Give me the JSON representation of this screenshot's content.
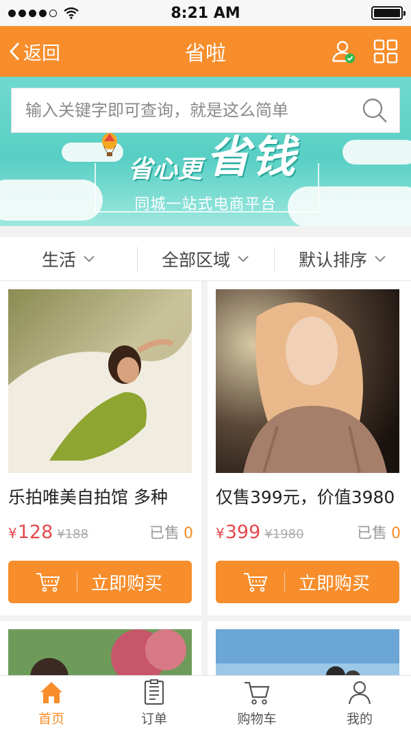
{
  "status_bar": {
    "time": "8:21 AM"
  },
  "header": {
    "back_label": "返回",
    "title": "省啦",
    "icons": [
      "user-verified-icon",
      "grid-icon"
    ]
  },
  "search": {
    "placeholder": "输入关键字即可查询，就是这么简单"
  },
  "banner": {
    "headline_small": "省心更",
    "headline_big": "省钱",
    "subtitle": "同城一站式电商平台"
  },
  "filters": [
    {
      "label": "生活"
    },
    {
      "label": "全部区域"
    },
    {
      "label": "默认排序"
    }
  ],
  "products": [
    {
      "title": "乐拍唯美自拍馆 多种",
      "currency": "¥",
      "price": "128",
      "old_price": "¥188",
      "sold_label": "已售",
      "sold_count": "0",
      "buy_label": "立即购买"
    },
    {
      "title": "仅售399元，价值3980",
      "currency": "¥",
      "price": "399",
      "old_price": "¥1980",
      "sold_label": "已售",
      "sold_count": "0",
      "buy_label": "立即购买"
    }
  ],
  "tabs": [
    {
      "label": "首页",
      "icon": "home-icon",
      "active": true
    },
    {
      "label": "订单",
      "icon": "order-icon",
      "active": false
    },
    {
      "label": "购物车",
      "icon": "cart-icon",
      "active": false
    },
    {
      "label": "我的",
      "icon": "profile-icon",
      "active": false
    }
  ],
  "colors": {
    "accent": "#f78d2b",
    "price": "#e5484d",
    "banner": "#58cfc4"
  }
}
